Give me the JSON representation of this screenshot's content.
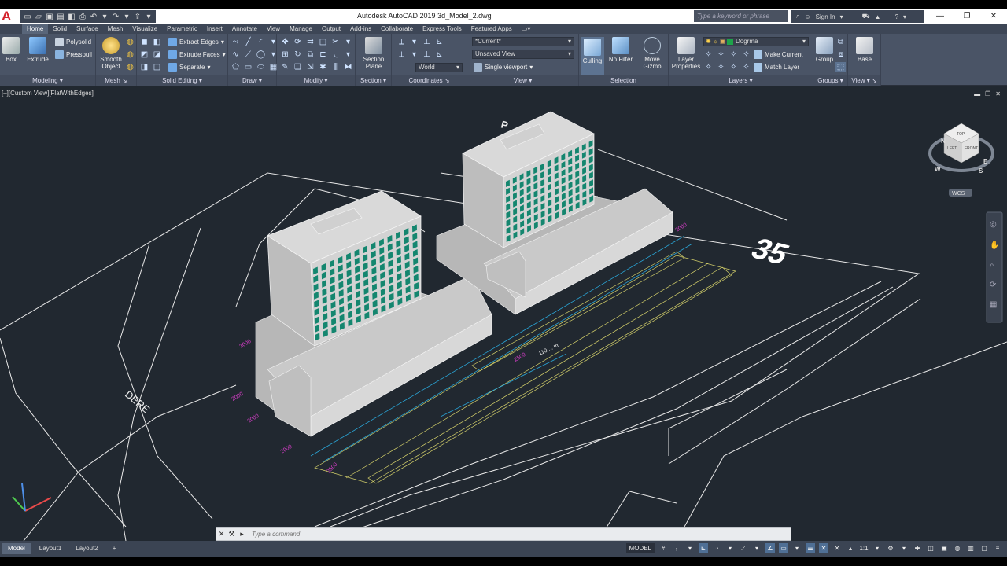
{
  "app": {
    "title": "Autodesk AutoCAD 2019    3d_Model_2.dwg",
    "logo_letter": "A",
    "search_placeholder": "Type a keyword or phrase",
    "sign_in": "Sign In"
  },
  "ribbon": {
    "tabs": [
      "Home",
      "Solid",
      "Surface",
      "Mesh",
      "Visualize",
      "Parametric",
      "Insert",
      "Annotate",
      "View",
      "Manage",
      "Output",
      "Add-ins",
      "Collaborate",
      "Express Tools",
      "Featured Apps"
    ],
    "active_tab": "Home",
    "modeling": {
      "title": "Modeling",
      "box": "Box",
      "extrude": "Extrude",
      "polysolid": "Polysolid",
      "presspull": "Presspull"
    },
    "mesh": {
      "title": "Mesh",
      "smooth_object": "Smooth Object"
    },
    "solid_editing": {
      "title": "Solid Editing",
      "extract_edges": "Extract Edges",
      "extrude_faces": "Extrude Faces",
      "separate": "Separate"
    },
    "draw": {
      "title": "Draw"
    },
    "modify": {
      "title": "Modify"
    },
    "section": {
      "title": "Section",
      "section_plane": "Section Plane"
    },
    "coordinates": {
      "title": "Coordinates",
      "world": "World"
    },
    "view": {
      "title": "View",
      "current": "*Current*",
      "unsaved_view": "Unsaved View",
      "single_viewport": "Single viewport"
    },
    "selection": {
      "title": "Selection",
      "culling": "Culling",
      "no_filter": "No Filter",
      "move_gizmo": "Move Gizmo"
    },
    "layers": {
      "title": "Layers",
      "layer_properties": "Layer Properties",
      "layer_combo": "Dogrma",
      "make_current": "Make Current",
      "match_layer": "Match Layer"
    },
    "groups": {
      "title": "Groups",
      "group": "Group"
    },
    "viewp": {
      "title": "View",
      "base": "Base"
    }
  },
  "viewport": {
    "label": "[–][Custom View][FlatWithEdges]",
    "annotations": {
      "dere": "DERE",
      "route": "35",
      "dim": "110 ... m",
      "p": "P"
    },
    "viewcube": {
      "top": "TOP",
      "left": "LEFT",
      "front": "FRONT",
      "n": "N",
      "w": "W",
      "s": "S",
      "e": "E",
      "wcs": "WCS"
    }
  },
  "command": {
    "placeholder": "Type a command"
  },
  "statusbar": {
    "layouts": [
      "Model",
      "Layout1",
      "Layout2"
    ],
    "model": "MODEL",
    "scale": "1:1"
  },
  "colors": {
    "window_glass": "#14866f",
    "building": "#c8c8c8",
    "background": "#212830"
  }
}
